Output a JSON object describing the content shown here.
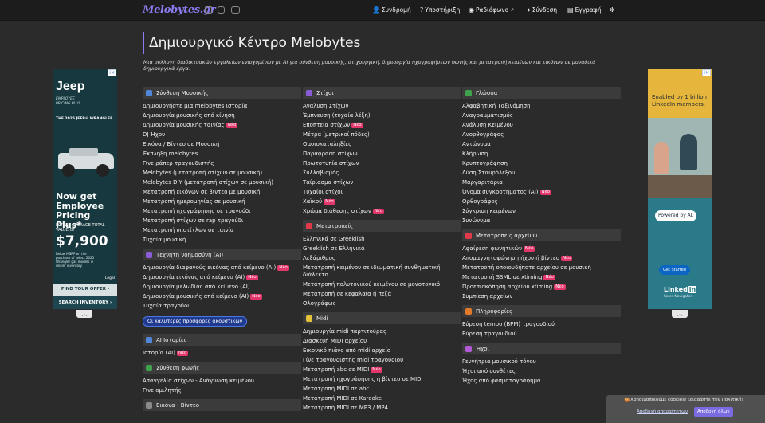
{
  "header": {
    "logo": "Melobytes.gr",
    "social": [
      "facebook-icon",
      "instagram-icon",
      "youtube-icon"
    ],
    "nav": [
      {
        "icon": "user-plus-icon",
        "glyph": "👤",
        "label": "Συνδρομή"
      },
      {
        "icon": "help-circle-icon",
        "glyph": "❓",
        "label": "Υποστήριξη"
      },
      {
        "icon": "radio-icon",
        "glyph": "📻",
        "label": "Ραδιόφωνο"
      },
      {
        "icon": "login-icon",
        "glyph": "➜",
        "label": "Σύνδεση"
      },
      {
        "icon": "register-icon",
        "glyph": "▤",
        "label": "Εγγραφή"
      },
      {
        "icon": "settings-icon",
        "glyph": "✻",
        "label": ""
      }
    ]
  },
  "page": {
    "title": "Δημιουργικό Κέντρο Melobytes",
    "intro": "Μια συλλογή διαδικτυακών εργαλείων ενισχυμένων με AI για σύνθεση μουσικής, στιχουργική, δημιουργία ηχογραφήσεων φωνής και μετατροπή κειμένων και εικόνων σε μοναδικά δημιουργικά έργα."
  },
  "badge_new": "Νέο",
  "columns": [
    {
      "categories": [
        {
          "title": "Σύνθεση Μουσικής",
          "icon": "music-note-icon",
          "color": "#4f86d9",
          "items": [
            {
              "label": "Δημιουργήστε μια melobytes ιστορία"
            },
            {
              "label": "Δημιουργία μουσικής από κίνηση"
            },
            {
              "label": "Δημιουργία μουσικής ταινίας",
              "new": true
            },
            {
              "label": "DJ Ήχου"
            },
            {
              "label": "Εικόνα / Βίντεο σε Μουσική"
            },
            {
              "label": "Έκπληξη melobytes"
            },
            {
              "label": "Γίνε ράπερ τραγουδιστής"
            },
            {
              "label": "Melobytes (μετατροπή στίχων σε μουσική)"
            },
            {
              "label": "Melobytes DIY (μετατροπή στίχων σε μουσική)"
            },
            {
              "label": "Μετατροπή εικόνων σε βίντεο με μουσική"
            },
            {
              "label": "Μετατροπή ημερομηνίας σε μουσική"
            },
            {
              "label": "Μετατροπή ηχογράφησης σε τραγούδι"
            },
            {
              "label": "Μετατροπή στίχων σε rap τραγούδι"
            },
            {
              "label": "Μετατροπή υποτίτλων σε ταινία"
            },
            {
              "label": "Τυχαία μουσική"
            }
          ]
        },
        {
          "title": "Τεχνητή νοημοσύνη (AI)",
          "icon": "brain-icon",
          "color": "#8a5cd8",
          "items": [
            {
              "label": "Δημιουργία διαφανούς εικόνας από κείμενο (AI)",
              "new": true
            },
            {
              "label": "Δημιουργία εικόνας από κείμενο (AI)",
              "new": true
            },
            {
              "label": "Δημιουργία μελωδίας από κείμενο (AI)"
            },
            {
              "label": "Δημιουργία μουσικής από κείμενο (AI)",
              "new": true
            },
            {
              "label": "Τυχαία τραγούδι"
            }
          ],
          "offer": "Οι καλύτερες προσφορές ακουστικών"
        },
        {
          "title": "AI Ιστορίες",
          "icon": "book-icon",
          "color": "#4f86d9",
          "items": [
            {
              "label": "Ιστορία (AI)",
              "new": true
            }
          ]
        },
        {
          "title": "Σύνθεση φωνής",
          "icon": "play-icon",
          "color": "#3fa34d",
          "items": [
            {
              "label": "Απαγγελία στίχων - Ανάγνωση κειμένου"
            },
            {
              "label": "Γίνε ομιλητής"
            }
          ]
        },
        {
          "title": "Εικόνα - Βίντεο",
          "icon": "image-icon",
          "color": "#8a8a8a",
          "items": []
        }
      ]
    },
    {
      "categories": [
        {
          "title": "Στίχοι",
          "icon": "pen-icon",
          "color": "#8a5cd8",
          "items": [
            {
              "label": "Ανάλυση Στίχων"
            },
            {
              "label": "Έμπνευση (τυχαία λέξη)"
            },
            {
              "label": "Εποπτεία στίχων",
              "new": true
            },
            {
              "label": "Μέτρα (μετρικοί πόδες)"
            },
            {
              "label": "Ομοιοκαταληξίες"
            },
            {
              "label": "Παράφραση στίχων"
            },
            {
              "label": "Πρωτοτυπία στίχων"
            },
            {
              "label": "Συλλαβισμός"
            },
            {
              "label": "Ταίριασμα στίχων"
            },
            {
              "label": "Τυχαίοι στίχοι"
            },
            {
              "label": "Χαϊκού",
              "new": true
            },
            {
              "label": "Χρώμα διάθεσης στίχων",
              "new": true
            }
          ]
        },
        {
          "title": "Μετατροπείς",
          "icon": "swap-icon",
          "color": "#e03a4a",
          "items": [
            {
              "label": "Ελληνικά σε Greeklish"
            },
            {
              "label": "Greeklish σε Ελληνικά"
            },
            {
              "label": "Λεξάριθμος"
            },
            {
              "label": "Μετατροπή κειμένου σε ιδιωματική συνθηματική διάλεκτο",
              "wrap": true
            },
            {
              "label": "Μετατροπή πολυτονικού κειμένου σε μονοτονικό"
            },
            {
              "label": "Μετατροπή σε κεφαλαία ή πεζά"
            },
            {
              "label": "Ολογράφως"
            }
          ]
        },
        {
          "title": "Midi",
          "icon": "file-icon",
          "color": "#e3c23a",
          "items": [
            {
              "label": "Δημιουργία midi παρτιτούρας"
            },
            {
              "label": "Διασκευή MIDI αρχείου"
            },
            {
              "label": "Εικονικό πιάνο από midi αρχείο"
            },
            {
              "label": "Γίνε τραγουδιστής midi τραγουδιού"
            },
            {
              "label": "Μετατροπή abc σε MIDI",
              "new": true
            },
            {
              "label": "Μετατροπή ηχογράφησης ή βίντεο σε MIDI"
            },
            {
              "label": "Μετατροπή MIDI σε abc"
            },
            {
              "label": "Μετατροπή MIDI σε Karaoke"
            },
            {
              "label": "Μετατροπή MIDI σε MP3 / MP4"
            }
          ]
        }
      ]
    },
    {
      "categories": [
        {
          "title": "Γλώσσα",
          "icon": "keyboard-icon",
          "color": "#3fa34d",
          "items": [
            {
              "label": "Αλφαβητική Ταξινόμηση"
            },
            {
              "label": "Αναγραμματισμός"
            },
            {
              "label": "Ανάλυση Κειμένου"
            },
            {
              "label": "Ανορθογράφος"
            },
            {
              "label": "Αντώνυμα"
            },
            {
              "label": "Κλήρωση"
            },
            {
              "label": "Κρυπτογράφηση"
            },
            {
              "label": "Λύση Σταυρόλεξου"
            },
            {
              "label": "Μαργαριτάρια"
            },
            {
              "label": "Όνομα συγκροτήματος (AI)",
              "new": true
            },
            {
              "label": "Ορθογράφος"
            },
            {
              "label": "Σύγκριση κειμένων"
            },
            {
              "label": "Συνώνυμα"
            }
          ]
        },
        {
          "title": "Μετατροπείς αρχείων",
          "icon": "file-convert-icon",
          "color": "#e03a4a",
          "items": [
            {
              "label": "Αφαίρεση φωνητικών",
              "new": true
            },
            {
              "label": "Απομαγνητοφώνηση ήχου ή βίντεο",
              "new": true
            },
            {
              "label": "Μετατροπή οποιουδήποτε αρχείου σε μουσική"
            },
            {
              "label": "Μετατροπή SSML σε xtiming",
              "new": true
            },
            {
              "label": "Προεπισκόπηση αρχείου xtiming",
              "new": true
            },
            {
              "label": "Συμπίεση αρχείων"
            }
          ]
        },
        {
          "title": "Πληροφορίες",
          "icon": "info-icon",
          "color": "#e07a2a",
          "items": [
            {
              "label": "Εύρεση tempo (BPM) τραγουδιού"
            },
            {
              "label": "Εύρεση τραγουδιού"
            }
          ]
        },
        {
          "title": "Ήχοι",
          "icon": "headphones-icon",
          "color": "#b35ad8",
          "items": [
            {
              "label": "Γεννήτρια μουσικού τόνου"
            },
            {
              "label": "Ήχοι από συνθέτες"
            },
            {
              "label": "Ήχος από φασματογράφημα"
            }
          ]
        }
      ]
    }
  ],
  "ads": {
    "left": {
      "brand": "Jeep",
      "sub": "EMPLOYEE PRICING PLUS",
      "model": "THE 2025 JEEP® WRANGLER",
      "headline": "Now get Employee Pricing Plus*",
      "avg": "FOR AN AVERAGE TOTAL VALUE OF",
      "price": "$7,900",
      "fine": "Below MSRP on the purchase of select 2025 Wrangler gas models in dealer inventory",
      "legal": "Legal",
      "cta1": "FIND YOUR OFFER ›",
      "cta2": "SEARCH INVENTORY ›"
    },
    "right": {
      "headline": "Enabled by 1 billion LinkedIn members.",
      "powered": "Powered by AI.",
      "cta": "Get Started",
      "brand": "Linked",
      "brand_in": "in",
      "sub": "Sales Navigator"
    }
  },
  "cookie": {
    "text": "Χρησιμοποιούμε cookies! (Διαβάστε την Πολιτική)",
    "reject": "Αποδοχή απαραίτητων",
    "accept": "Αποδοχή όλων"
  }
}
